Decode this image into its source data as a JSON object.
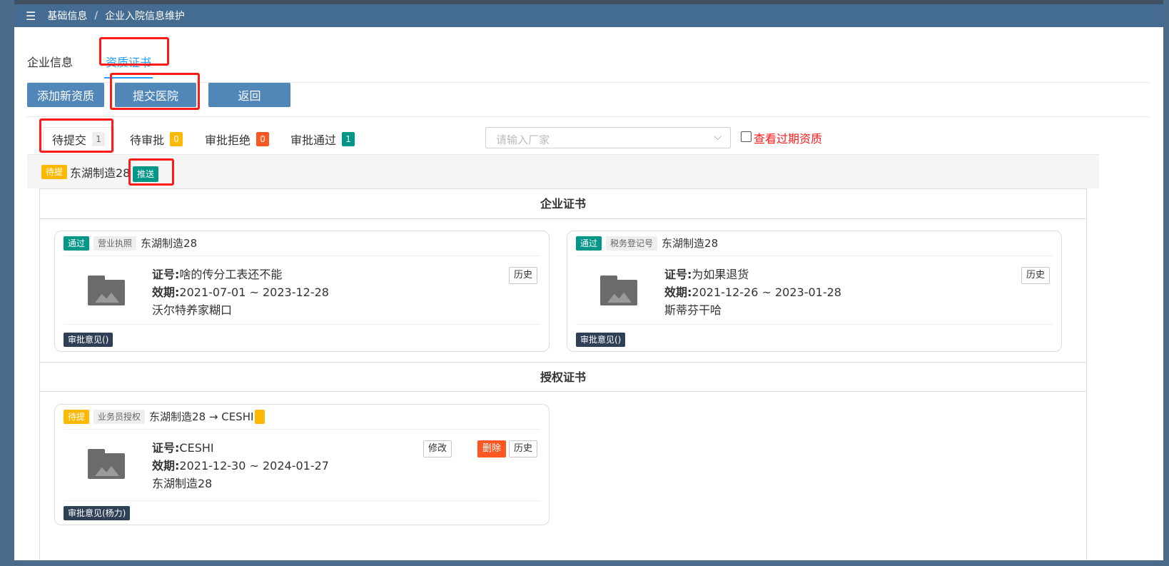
{
  "breadcrumb": {
    "menu_icon": "hamburger-icon",
    "items": [
      "基础信息",
      "企业入院信息维护"
    ],
    "separator": "/"
  },
  "main_tabs": [
    {
      "label": "企业信息"
    },
    {
      "label": "资质证书",
      "active": true
    }
  ],
  "actions": {
    "add_label": "添加新资质",
    "submit_label": "提交医院",
    "back_label": "返回"
  },
  "sub_tabs": [
    {
      "label": "待提交",
      "count": "1",
      "active": true
    },
    {
      "label": "待审批",
      "count": "0"
    },
    {
      "label": "审批拒绝",
      "count": "0"
    },
    {
      "label": "审批通过",
      "count": "1"
    }
  ],
  "filter": {
    "placeholder": "请输入厂家",
    "expired_label": "查看过期资质"
  },
  "company": {
    "status": "待提",
    "name": "东湖制造28",
    "push_label": "推送"
  },
  "sections": {
    "enterprise_title": "企业证书",
    "auth_title": "授权证书"
  },
  "cards": [
    {
      "status": "通过",
      "type": "营业执照",
      "name": "东湖制造28",
      "cert_label": "证号:",
      "cert_no": "啥的传分工表还不能",
      "period_label": "效期:",
      "period": "2021-07-01 ~ 2023-12-28",
      "note": "沃尔特养家糊口",
      "history_label": "历史",
      "opinion": "审批意见()"
    },
    {
      "status": "通过",
      "type": "税务登记号",
      "name": "东湖制造28",
      "cert_label": "证号:",
      "cert_no": "为如果退货",
      "period_label": "效期:",
      "period": "2021-12-26 ~ 2023-01-28",
      "note": "斯蒂芬干哈",
      "history_label": "历史",
      "opinion": "审批意见()"
    },
    {
      "status": "待提",
      "type": "业务员授权",
      "name": "东湖制造28 → CESHI",
      "cert_label": "证号:",
      "cert_no": "CESHI",
      "period_label": "效期:",
      "period": "2021-12-30 ~ 2024-01-27",
      "note": "东湖制造28",
      "edit_label": "修改",
      "delete_label": "删除",
      "history_label": "历史",
      "opinion": "审批意见(杨力)"
    }
  ],
  "colors": {
    "topbar": "#446c92",
    "button": "#5087b8",
    "link_active": "#1e9fff",
    "highlight": "#ff1a1a",
    "teal": "#009688",
    "yellow": "#ffb800",
    "orange": "#ff5722",
    "dark": "#2f4056"
  }
}
